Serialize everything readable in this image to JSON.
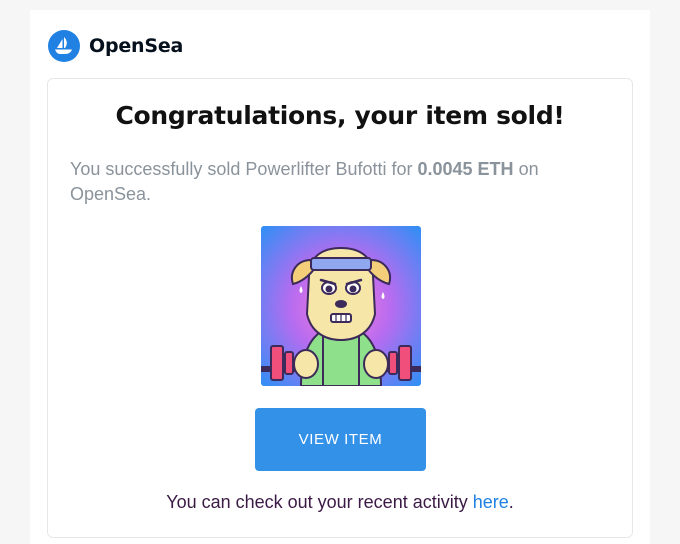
{
  "brand": {
    "name": "OpenSea",
    "logo_icon": "opensea-sailboat-icon",
    "color": "#2081e2"
  },
  "email": {
    "headline": "Congratulations, your item sold!",
    "message_prefix": "You successfully sold Powerlifter Bufotti for ",
    "price": "0.0045 ETH",
    "message_suffix": " on OpenSea.",
    "item_name": "Powerlifter Bufotti",
    "item_image_icon": "powerlifter-dog-nft-image",
    "cta_label": "VIEW ITEM",
    "cta_color": "#3491e8",
    "footer_prefix": "You can check out your recent activity ",
    "footer_link": "here",
    "footer_suffix": "."
  }
}
